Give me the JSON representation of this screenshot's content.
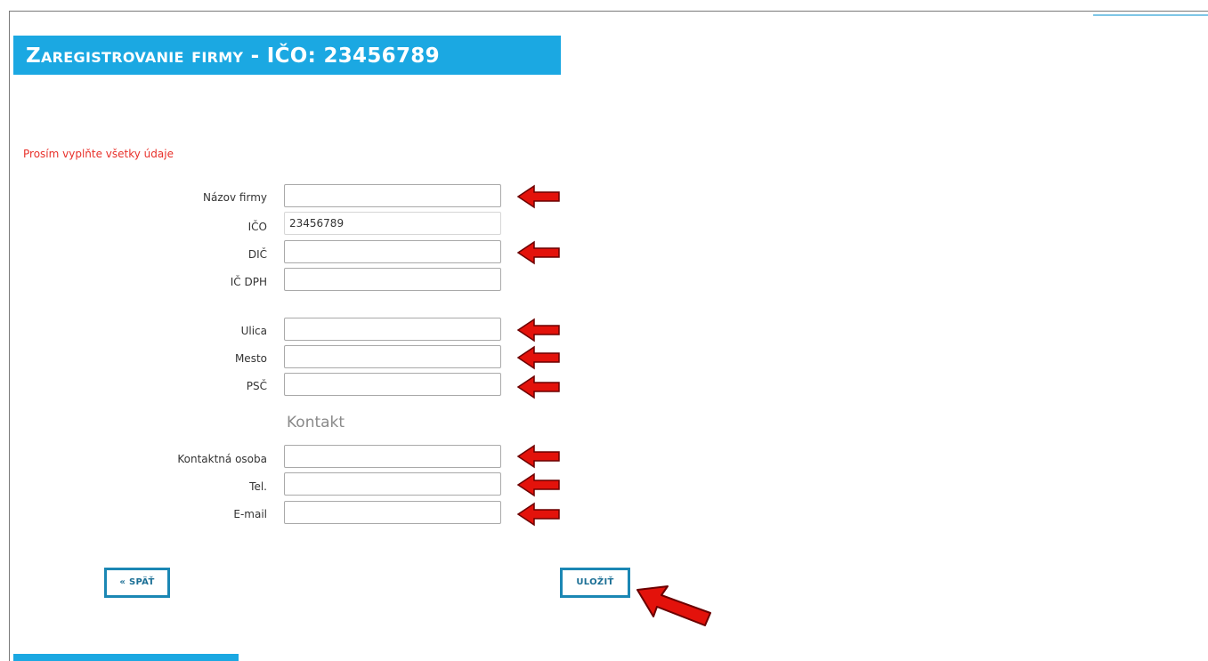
{
  "header": {
    "title": "Zaregistrovanie firmy - IČO: 23456789"
  },
  "form": {
    "notice": "Prosím vyplňte všetky údaje",
    "fields": {
      "company_name": {
        "label": "Názov firmy",
        "value": ""
      },
      "ico": {
        "label": "IČO",
        "value": "23456789"
      },
      "dic": {
        "label": "DIČ",
        "value": ""
      },
      "ic_dph": {
        "label": "IČ DPH",
        "value": ""
      },
      "street": {
        "label": "Ulica",
        "value": ""
      },
      "city": {
        "label": "Mesto",
        "value": ""
      },
      "psc": {
        "label": "PSČ",
        "value": ""
      },
      "contact_person": {
        "label": "Kontaktná osoba",
        "value": ""
      },
      "phone": {
        "label": "Tel.",
        "value": ""
      },
      "email": {
        "label": "E-mail",
        "value": ""
      }
    },
    "contact_heading": "Kontakt"
  },
  "buttons": {
    "back_label": "« SPÄŤ",
    "save_label": "ULOŽIŤ"
  },
  "colors": {
    "banner": "#1ba8e2",
    "notice": "#e8302a",
    "button_border": "#1b87b4",
    "arrow": "#e3120b"
  },
  "icons": {
    "field_marker": "red-arrow-left-icon",
    "save_marker": "red-arrow-up-left-icon"
  }
}
